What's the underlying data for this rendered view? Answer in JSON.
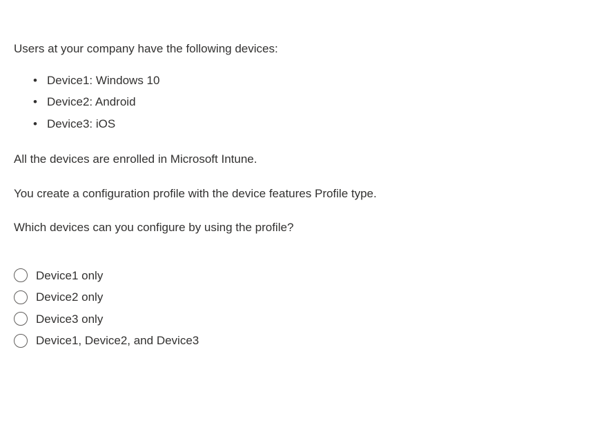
{
  "question": {
    "intro": "Users at your company have the following devices:",
    "devices": [
      "Device1: Windows 10",
      "Device2: Android",
      "Device3: iOS"
    ],
    "paragraph1": "All the devices are enrolled in Microsoft Intune.",
    "paragraph2": "You create a configuration profile with the device features Profile type.",
    "paragraph3": "Which devices can you configure by using the profile?"
  },
  "options": [
    "Device1 only",
    "Device2 only",
    "Device3 only",
    "Device1, Device2, and Device3"
  ]
}
